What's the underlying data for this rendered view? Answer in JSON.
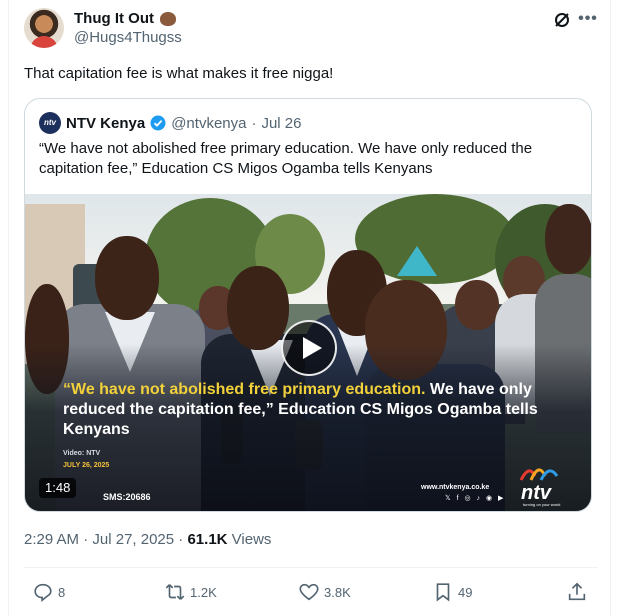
{
  "author": {
    "display_name": "Thug It Out",
    "handle": "@Hugs4Thugss",
    "name_emoji": "poop-emoji"
  },
  "header_icons": [
    "grok-icon",
    "more-icon"
  ],
  "tweet": {
    "text": "That capitation fee is what makes it free nigga!"
  },
  "quoted": {
    "name": "NTV Kenya",
    "handle": "@ntvkenya",
    "separator": "·",
    "date": "Jul 26",
    "avatar_text": "ntv",
    "text": "“We have not abolished free primary education. We have only reduced the capitation fee,” Education CS Migos Ogamba tells Kenyans",
    "video": {
      "caption_highlight": "“We have not abolished free primary education.",
      "caption_rest": " We have only reduced the capitation fee,” Education CS Migos Ogamba tells Kenyans",
      "credit": "Video: NTV",
      "video_date": "JULY 26, 2025",
      "sms": "SMS:20686",
      "url": "www.ntvkenya.co.ke",
      "social_icons": "𝕏 f ◎ ♪ ◉ ▶",
      "logo_word": "ntv",
      "logo_tagline": "turning on your world",
      "duration": "1:48"
    }
  },
  "meta": {
    "time": "2:29 AM",
    "separator": "·",
    "date": "Jul 27, 2025",
    "separator2": "·",
    "views_count": "61.1K",
    "views_label": "Views"
  },
  "actions": {
    "replies": "8",
    "reposts": "1.2K",
    "likes": "3.8K",
    "bookmarks": "49"
  },
  "colors": {
    "text": "#0f1419",
    "secondary": "#536471",
    "border": "#cfd9de",
    "verified": "#1d9bf0",
    "caption_highlight": "#f2d13a"
  }
}
